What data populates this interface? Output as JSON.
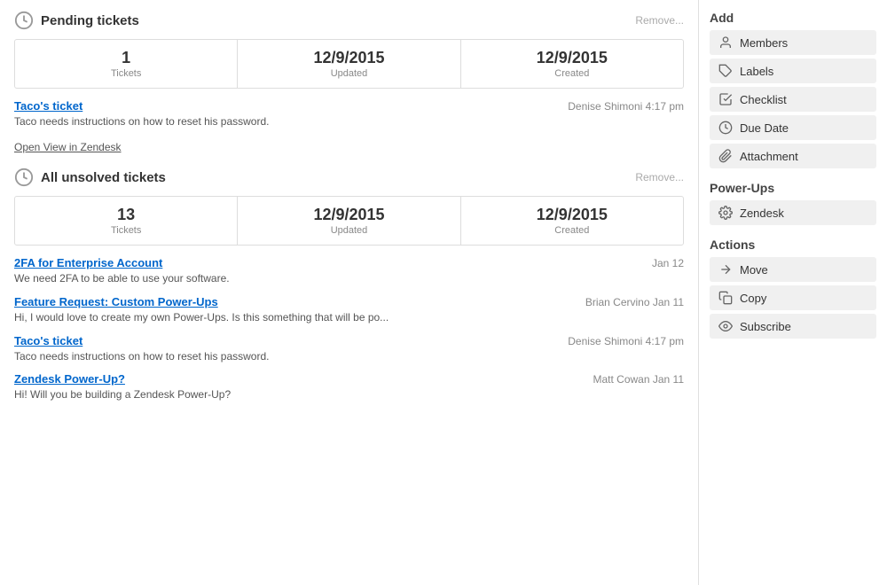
{
  "pending": {
    "title": "Pending tickets",
    "remove_label": "Remove...",
    "stats": [
      {
        "value": "1",
        "label": "Tickets"
      },
      {
        "value": "12/9/2015",
        "label": "Updated"
      },
      {
        "value": "12/9/2015",
        "label": "Created"
      }
    ],
    "tickets": [
      {
        "title": "Taco's ticket",
        "meta": "Denise Shimoni  4:17 pm",
        "desc": "Taco needs instructions on how to reset his password."
      }
    ],
    "open_view_label": "Open View in Zendesk"
  },
  "unsolved": {
    "title": "All unsolved tickets",
    "remove_label": "Remove...",
    "stats": [
      {
        "value": "13",
        "label": "Tickets"
      },
      {
        "value": "12/9/2015",
        "label": "Updated"
      },
      {
        "value": "12/9/2015",
        "label": "Created"
      }
    ],
    "tickets": [
      {
        "title": "2FA for Enterprise Account",
        "meta": "Jan 12",
        "desc": "We need 2FA to be able to use your software."
      },
      {
        "title": "Feature Request: Custom Power-Ups",
        "meta": "Brian Cervino  Jan 11",
        "desc": "Hi, I would love to create my own Power-Ups. Is this something that will be po..."
      },
      {
        "title": "Taco's ticket",
        "meta": "Denise Shimoni  4:17 pm",
        "desc": "Taco needs instructions on how to reset his password."
      },
      {
        "title": "Zendesk Power-Up?",
        "meta": "Matt Cowan  Jan 11",
        "desc": "Hi! Will you be building a Zendesk Power-Up?"
      }
    ]
  },
  "sidebar": {
    "add_title": "Add",
    "add_buttons": [
      {
        "label": "Members",
        "icon": "person"
      },
      {
        "label": "Labels",
        "icon": "tag"
      },
      {
        "label": "Checklist",
        "icon": "checklist"
      },
      {
        "label": "Due Date",
        "icon": "clock"
      },
      {
        "label": "Attachment",
        "icon": "paperclip"
      }
    ],
    "powerups_title": "Power-Ups",
    "powerups_buttons": [
      {
        "label": "Zendesk",
        "icon": "gear"
      }
    ],
    "actions_title": "Actions",
    "actions_buttons": [
      {
        "label": "Move",
        "icon": "arrow"
      },
      {
        "label": "Copy",
        "icon": "copy"
      },
      {
        "label": "Subscribe",
        "icon": "eye"
      }
    ]
  }
}
